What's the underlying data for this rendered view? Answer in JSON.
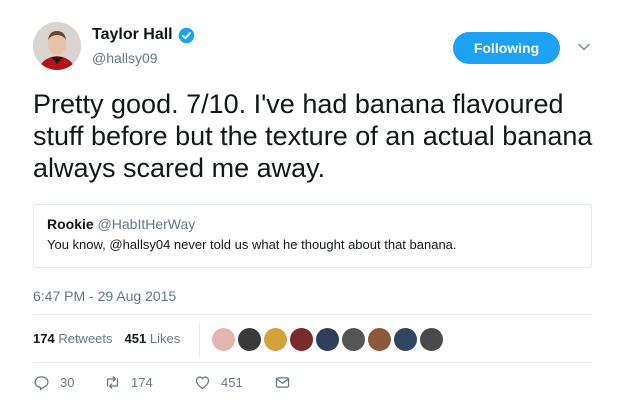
{
  "author": {
    "name": "Taylor Hall",
    "handle": "@hallsy09",
    "verified": true
  },
  "follow_button": {
    "label": "Following"
  },
  "tweet": {
    "text": "Pretty good. 7/10. I've had banana flavoured stuff before but the texture of an actual banana always scared me away.",
    "timestamp": "6:47 PM - 29 Aug 2015"
  },
  "quoted_tweet": {
    "name": "Rookie",
    "handle": "@HabItHerWay",
    "text": "You know, @hallsy04 never told us what he thought about that banana."
  },
  "stats": {
    "retweets_count": "174",
    "retweets_label": "Retweets",
    "likes_count": "451",
    "likes_label": "Likes"
  },
  "liker_avatar_colors": [
    "#e3b5b0",
    "#3a3a3a",
    "#d4a23a",
    "#7a2a2a",
    "#2f3f5a",
    "#555555",
    "#8a5a3a",
    "#2f4560",
    "#4a4a4a"
  ],
  "actions": {
    "reply_count": "30",
    "retweet_count": "174",
    "like_count": "451"
  },
  "colors": {
    "accent": "#1da1f2",
    "secondary_text": "#657786"
  }
}
